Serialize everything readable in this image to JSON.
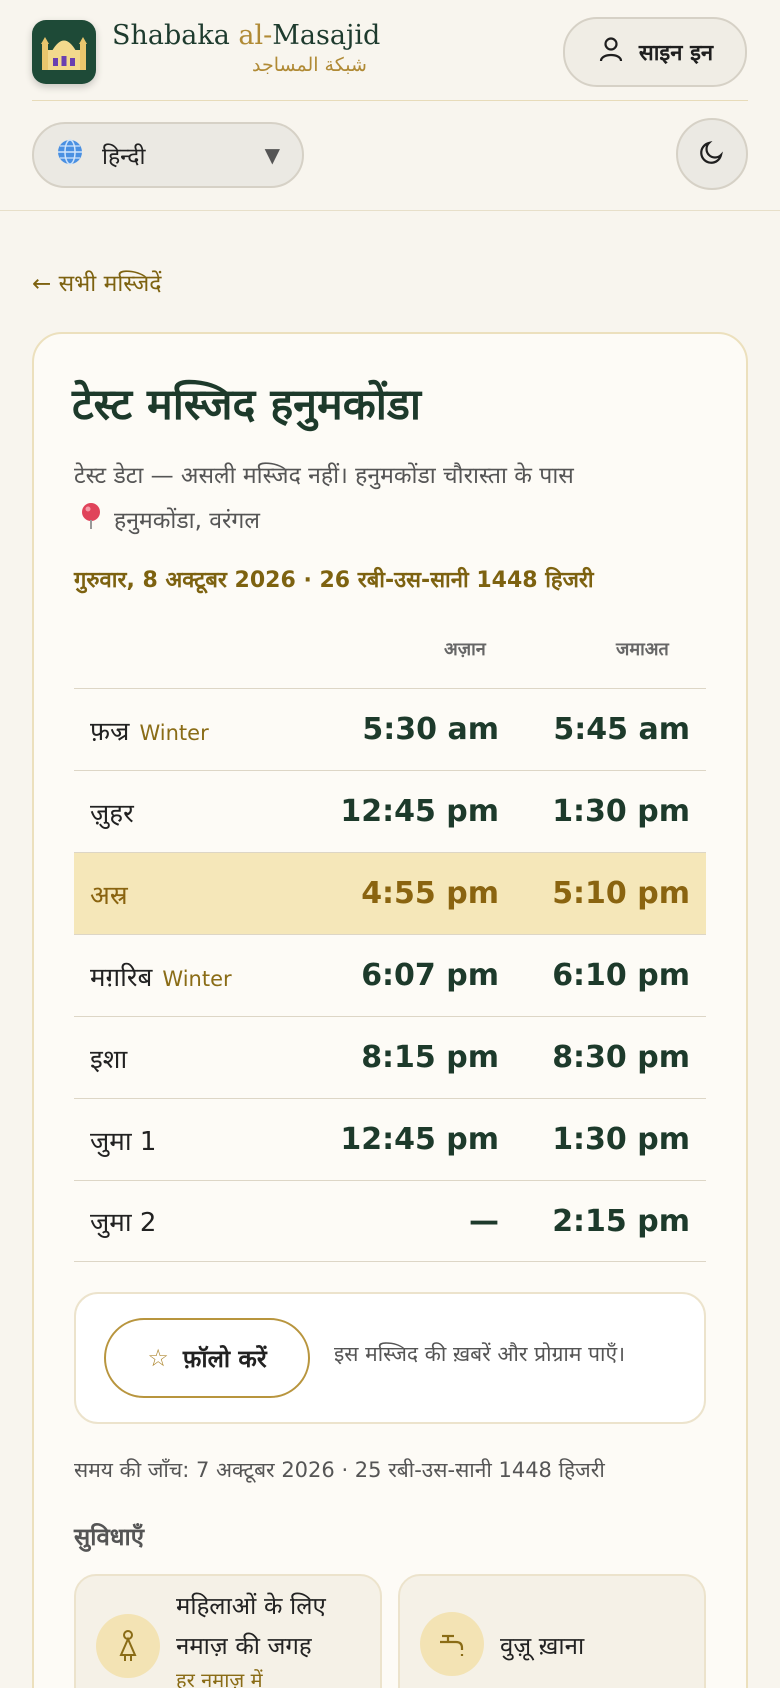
{
  "header": {
    "brand_en_prefix": "Shabaka ",
    "brand_en_accent": "al-",
    "brand_en_suffix": "Masajid",
    "brand_ar": "شبكة المساجد",
    "signin_label": "साइन इन",
    "language": "हिन्दी"
  },
  "back_link": "← सभी मस्जिदें",
  "mosque": {
    "title": "टेस्ट मस्जिद हनुमकोंडा",
    "description": "टेस्ट डेटा — असली मस्जिद नहीं। हनुमकोंडा चौरास्ता के पास",
    "location": "हनुमकोंडा, वरंगल",
    "date": "गुरुवार, 8 अक्टूबर 2026 · 26 रबी-उस-सानी 1448 हिजरी"
  },
  "table": {
    "col_adhan": "अज़ान",
    "col_jamaat": "जमाअत",
    "rows": [
      {
        "name": "फ़ज्र",
        "tag": "Winter",
        "adhan": "5:30 am",
        "jamaat": "5:45 am"
      },
      {
        "name": "ज़ुहर",
        "tag": "",
        "adhan": "12:45 pm",
        "jamaat": "1:30 pm"
      },
      {
        "name": "अस्र",
        "tag": "",
        "adhan": "4:55 pm",
        "jamaat": "5:10 pm"
      },
      {
        "name": "मग़रिब",
        "tag": "Winter",
        "adhan": "6:07 pm",
        "jamaat": "6:10 pm"
      },
      {
        "name": "इशा",
        "tag": "",
        "adhan": "8:15 pm",
        "jamaat": "8:30 pm"
      },
      {
        "name": "जुमा 1",
        "tag": "",
        "adhan": "12:45 pm",
        "jamaat": "1:30 pm"
      },
      {
        "name": "जुमा 2",
        "tag": "",
        "adhan": "—",
        "jamaat": "2:15 pm"
      }
    ]
  },
  "follow": {
    "button_label": "फ़ॉलो करें",
    "text": "इस मस्जिद की ख़बरें और प्रोग्राम पाएँ।"
  },
  "checked": "समय की जाँच: 7 अक्टूबर 2026 · 25 रबी-उस-सानी 1448 हिजरी",
  "facilities": {
    "heading": "सुविधाएँ",
    "items": [
      {
        "label_line1": "महिलाओं के लिए",
        "label_line2": "नमाज़ की जगह",
        "sub": "हर नमाज़ में"
      },
      {
        "label_line1": "वुज़ू ख़ाना"
      }
    ]
  },
  "colors": {
    "brand_green": "#1e4a37",
    "accent_gold": "#b08a35",
    "highlight_row": "#f5e7b9"
  }
}
